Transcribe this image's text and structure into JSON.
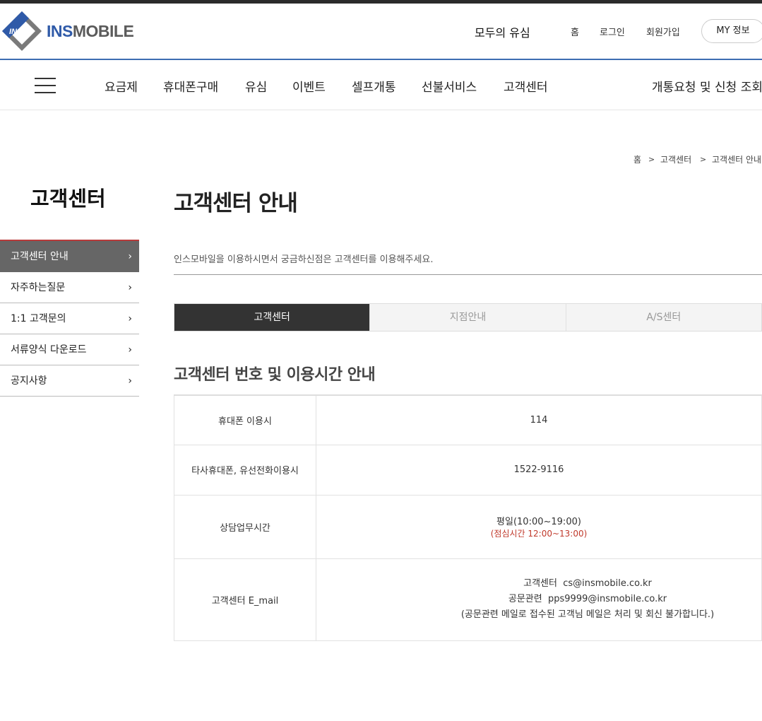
{
  "header": {
    "logo_ins": "INS",
    "logo_mobile": "MOBILE",
    "modu": "모두의 유심",
    "links": [
      "홈",
      "로그인",
      "회원가입"
    ],
    "my_info": "MY 정보"
  },
  "gnb": {
    "items": [
      "요금제",
      "휴대폰구매",
      "유심",
      "이벤트",
      "셀프개통",
      "선불서비스",
      "고객센터"
    ],
    "right": "개통요청 및 신청 조회"
  },
  "breadcrumb": [
    "홈",
    "고객센터",
    "고객센터 안내"
  ],
  "sidebar": {
    "title": "고객센터",
    "items": [
      {
        "label": "고객센터 안내"
      },
      {
        "label": "자주하는질문"
      },
      {
        "label": "1:1 고객문의"
      },
      {
        "label": "서류양식 다운로드"
      },
      {
        "label": "공지사항"
      }
    ]
  },
  "main": {
    "title": "고객센터 안내",
    "intro": "인스모바일을 이용하시면서 궁금하신점은 고객센터를 이용해주세요.",
    "tabs": [
      "고객센터",
      "지점안내",
      "A/S센터"
    ],
    "section_title": "고객센터 번호 및 이용시간 안내",
    "rows": [
      {
        "label": "휴대폰 이용시",
        "value": "114"
      },
      {
        "label": "타사휴대폰, 유선전화이용시",
        "value": "1522-9116"
      },
      {
        "label": "상담업무시간",
        "value": "평일(10:00~19:00)",
        "note": "(점심시간 12:00~13:00)"
      },
      {
        "label": "고객센터 E_mail",
        "lines": [
          "고객센터  cs@insmobile.co.kr",
          "공문관련  pps9999@insmobile.co.kr",
          "(공문관련 메일로 접수된 고객님 메일은 처리 및 회신 불가합니다.)"
        ]
      }
    ]
  },
  "colors": {
    "accent_blue": "#3d6db2",
    "active_tab": "#333333",
    "active_side": "#666666",
    "note_red": "#c0392b"
  }
}
